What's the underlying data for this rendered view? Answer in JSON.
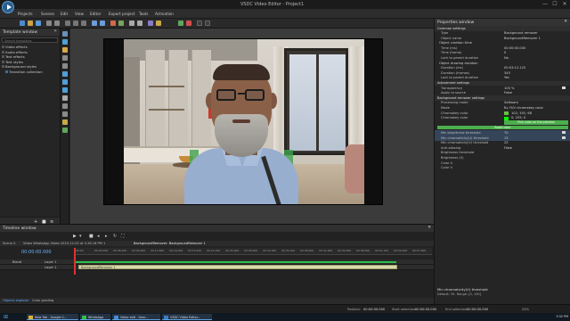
{
  "window": {
    "title": "VSDC Video Editor - Project1",
    "minimize": "—",
    "maximize": "☐",
    "close": "✕"
  },
  "menu": [
    "Projects",
    "Scenes",
    "Edit",
    "View",
    "Editor",
    "Export project",
    "Tools",
    "Activation"
  ],
  "left_panel": {
    "title": "Template window",
    "search_placeholder": "Search templates",
    "items": [
      {
        "label": "Video effects",
        "level": 0
      },
      {
        "label": "Audio effects",
        "level": 0
      },
      {
        "label": "Text effects",
        "level": 0
      },
      {
        "label": "Text styles",
        "level": 0
      },
      {
        "label": "Background styles",
        "level": 0
      },
      {
        "label": "Transition collection",
        "level": 1
      }
    ]
  },
  "properties": {
    "title": "Properties window",
    "rows": [
      {
        "type": "section",
        "key": "Common settings"
      },
      {
        "type": "row",
        "key": "Type",
        "value": "Background remover"
      },
      {
        "type": "row",
        "key": "Object name",
        "value": "BackgroundRemover 1"
      },
      {
        "type": "sub",
        "key": "Object creation time"
      },
      {
        "type": "row",
        "key": "Time (ms)",
        "value": "00:00:00.000"
      },
      {
        "type": "row",
        "key": "Time (frame)",
        "value": "0"
      },
      {
        "type": "row",
        "key": "Lock to parent duration",
        "value": "No"
      },
      {
        "type": "sub",
        "key": "Object drawing duration"
      },
      {
        "type": "row",
        "key": "Duration (ms)",
        "value": "00:03:12.120"
      },
      {
        "type": "row",
        "key": "Duration (frames)",
        "value": "345"
      },
      {
        "type": "row",
        "key": "Lock to parent duration",
        "value": "Yes"
      },
      {
        "type": "section",
        "key": "Adjustment settings"
      },
      {
        "type": "row",
        "key": "Transparency",
        "value": "100 %"
      },
      {
        "type": "row",
        "key": "Apply to source",
        "value": "False"
      },
      {
        "type": "section",
        "key": "Background remover settings"
      },
      {
        "type": "row",
        "key": "Processing mode",
        "value": "Software"
      },
      {
        "type": "row",
        "key": "Mode",
        "value": "By YUV chromakey color"
      },
      {
        "type": "swatch",
        "key": "Chromakey color",
        "value": "102; 191; 68"
      },
      {
        "type": "swatch",
        "key": "Chromakey color",
        "value": "0; 255; 0"
      },
      {
        "type": "button",
        "value": "Pick color on the preview"
      },
      {
        "type": "button-full",
        "value": "Reset color"
      },
      {
        "type": "row-hl",
        "key": "Min brightness threshold",
        "value": "70"
      },
      {
        "type": "row-hl",
        "key": "Min chromaticity(U) threshold",
        "value": "13"
      },
      {
        "type": "row",
        "key": "Min chromaticity(V) threshold",
        "value": "25"
      },
      {
        "type": "row",
        "key": "Anti-aliasing",
        "value": "False"
      },
      {
        "type": "row",
        "key": "Brightness threshold",
        "value": ""
      },
      {
        "type": "row",
        "key": "Brightness (V)",
        "value": ""
      },
      {
        "type": "row",
        "key": "Color U",
        "value": ""
      },
      {
        "type": "row",
        "key": "Color V",
        "value": ""
      }
    ],
    "desc_title": "Min chromaticity(U) threshold",
    "desc_text": "Default: 35. Range: [0, 100]"
  },
  "timeline": {
    "title": "Timeline window",
    "tabs": [
      "Scene 0",
      "Video WhatsApp Video 2023-12-02 at 3.26.16 PM 1",
      "BackgroundRemover: BackgroundRemover 1"
    ],
    "timecode": "00:00:00.000",
    "ticks": [
      "00:00",
      "00:03.200",
      "00:06.400",
      "00:09.600",
      "00:12.800",
      "00:16.000",
      "00:19.200",
      "00:22.400",
      "00:25.600",
      "00:28.800",
      "00:32.000",
      "00:35.200",
      "00:38.400",
      "00:41.600",
      "00:44.800",
      "00:48.000",
      "00:51.200",
      "00:54.400",
      "00:57.600"
    ],
    "tracks": [
      {
        "name": "Blend",
        "layer": "Layer 1",
        "clip": ""
      },
      {
        "name": "",
        "layer": "Layer 1",
        "clip": "BackgroundRemover 1"
      }
    ]
  },
  "bottom_tabs": [
    "Objects explorer",
    "Color grading"
  ],
  "status": {
    "position": "Position:",
    "position_value": "00:00:00.000",
    "start": "Start selection:",
    "start_value": "00:00:00.000",
    "end": "End selection:",
    "end_value": "00:00:00.000",
    "zoom": "24%"
  },
  "taskbar": {
    "items": [
      "Now Tab - Google C...",
      "WhatsApp",
      "Video edit - Sear...",
      "VSDC Video Editor..."
    ],
    "clock": "3:32 PM"
  },
  "colors": {
    "accent": "#3fa34d",
    "swatch1": "#66bf44",
    "swatch2": "#00ff00",
    "highlight": "#34455a"
  }
}
